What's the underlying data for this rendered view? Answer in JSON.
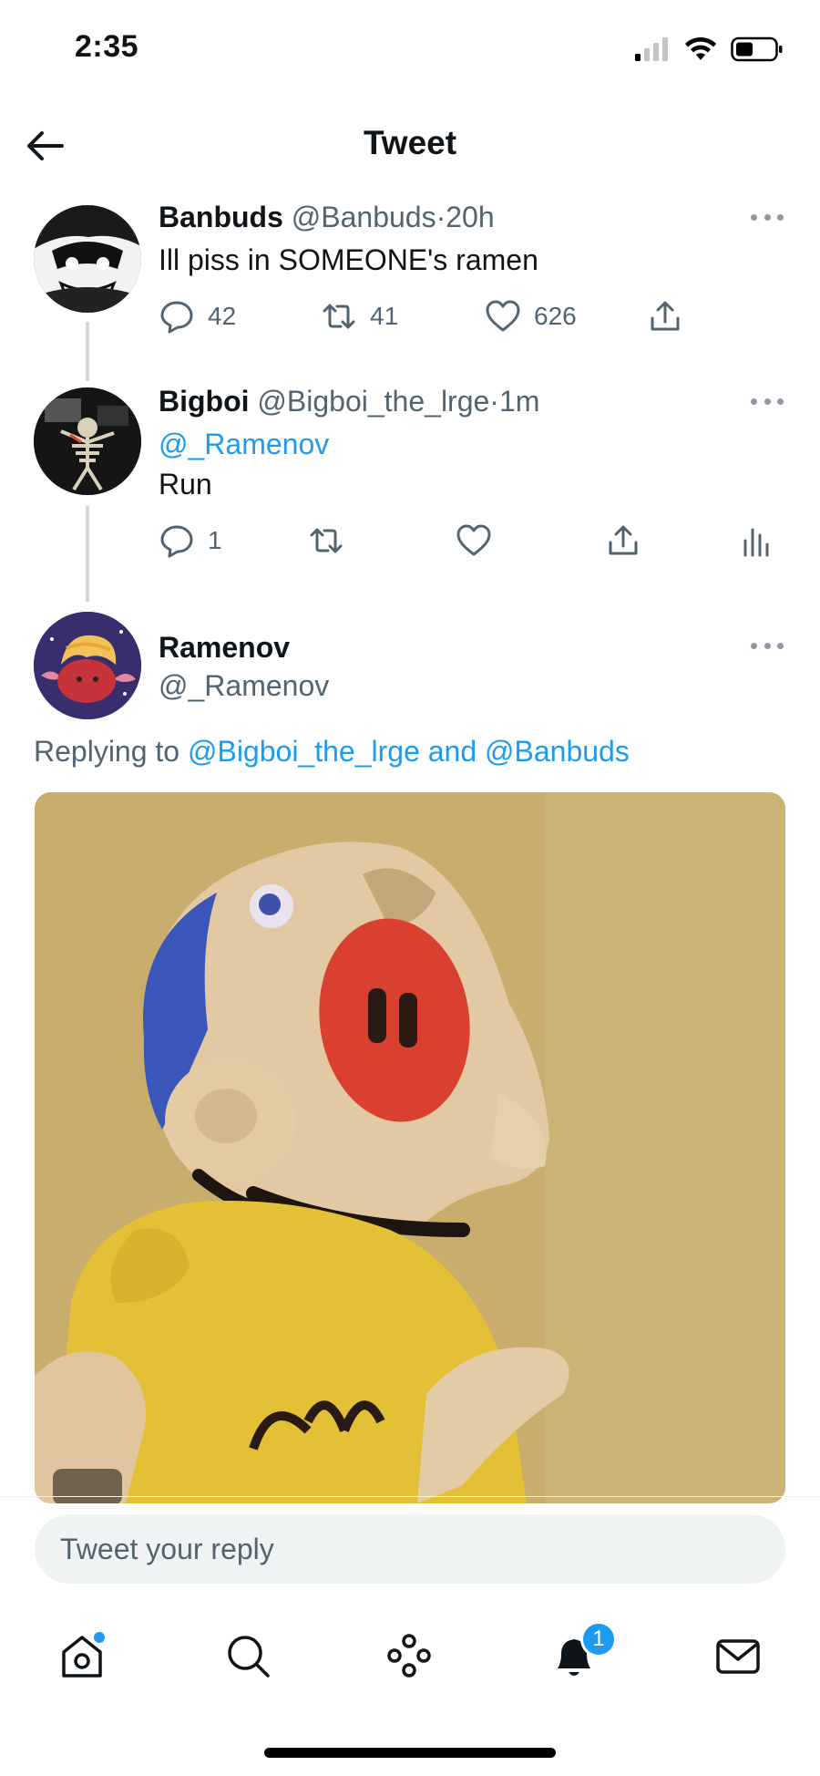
{
  "status_bar": {
    "time": "2:35"
  },
  "header": {
    "title": "Tweet"
  },
  "tweets": [
    {
      "name": "Banbuds",
      "handle": "@Banbuds",
      "separator": "·",
      "time": "20h",
      "text": "Ill piss in SOMEONE's ramen",
      "replies": "42",
      "retweets": "41",
      "likes": "626"
    },
    {
      "name": "Bigboi",
      "handle": "@Bigboi_the_lrge",
      "separator": "·",
      "time": "1m",
      "mention": "@_Ramenov",
      "text": "Run",
      "replies": "1"
    },
    {
      "name": "Ramenov",
      "handle": "@_Ramenov",
      "replying_prefix": "Replying to",
      "replying_to": "@Bigboi_the_lrge and @Banbuds"
    }
  ],
  "composer": {
    "placeholder": "Tweet your reply"
  },
  "tabbar": {
    "items": [
      "home-icon",
      "search-icon",
      "spaces-icon",
      "notifications-icon",
      "messages-icon"
    ],
    "notification_count": "1"
  },
  "colors": {
    "accent": "#1d9bf0",
    "secondary_text": "#536471",
    "thread_line": "#cfd9de"
  }
}
